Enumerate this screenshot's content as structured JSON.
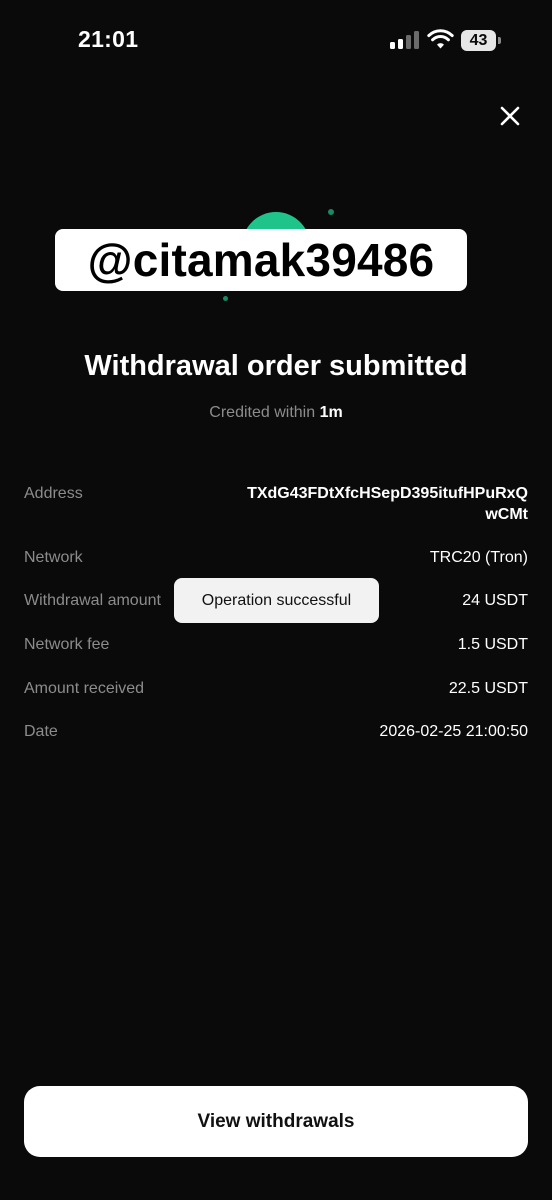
{
  "status_bar": {
    "time": "21:01",
    "battery": "43",
    "signal_icon": "signal-bars-icon",
    "wifi_icon": "wifi-icon"
  },
  "close_icon": "close-icon",
  "watermark": "@citamak39486",
  "title": "Withdrawal order submitted",
  "credited": {
    "prefix": "Credited within ",
    "value": "1m"
  },
  "details": {
    "address": {
      "label": "Address",
      "value": "TXdG43FDtXfcHSepD395itufHPuRxQwCMt"
    },
    "network": {
      "label": "Network",
      "value": "TRC20 (Tron)"
    },
    "withdrawal_amount": {
      "label": "Withdrawal amount",
      "value": "24 USDT"
    },
    "network_fee": {
      "label": "Network fee",
      "value": "1.5 USDT"
    },
    "amount_received": {
      "label": "Amount received",
      "value": "22.5 USDT"
    },
    "date": {
      "label": "Date",
      "value": "2026-02-25 21:00:50"
    }
  },
  "toast": "Operation successful",
  "button": {
    "label": "View withdrawals"
  },
  "colors": {
    "background": "#0a0a0a",
    "accent_green": "#1fc48a",
    "muted_text": "#8c8c8c"
  }
}
